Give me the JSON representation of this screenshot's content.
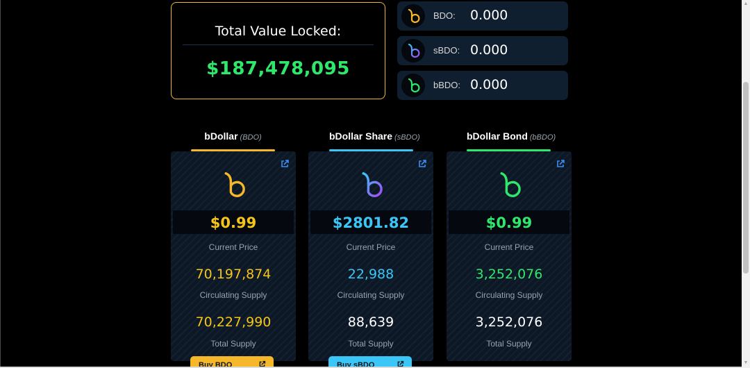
{
  "tvl": {
    "title": "Total Value Locked:",
    "value": "$187,478,095"
  },
  "balances": [
    {
      "icon": "bdo-logo-icon",
      "label": "BDO:",
      "value": "0.000",
      "color": "#f5b82a"
    },
    {
      "icon": "sbdo-logo-icon",
      "label": "sBDO:",
      "value": "0.000",
      "color": "#7f5cf7"
    },
    {
      "icon": "bbdo-logo-icon",
      "label": "bBDO:",
      "value": "0.000",
      "color": "#2fe86b"
    }
  ],
  "tokens": [
    {
      "name": "bDollar",
      "symbol": "(BDO)",
      "accent": "#f5b82a",
      "price": "$0.99",
      "price_label": "Current Price",
      "circulating": "70,197,874",
      "circulating_label": "Circulating Supply",
      "total": "70,227,990",
      "total_label": "Total Supply",
      "buy_label": "Buy BDO"
    },
    {
      "name": "bDollar Share",
      "symbol": "(sBDO)",
      "accent": "#3ac6f7",
      "price": "$2801.82",
      "price_label": "Current Price",
      "circulating": "22,988",
      "circulating_label": "Circulating Supply",
      "total": "88,639",
      "total_label": "Total Supply",
      "buy_label": "Buy sBDO"
    },
    {
      "name": "bDollar Bond",
      "symbol": "(bBDO)",
      "accent": "#2fe86b",
      "price": "$0.99",
      "price_label": "Current Price",
      "circulating": "3,252,076",
      "circulating_label": "Circulating Supply",
      "total": "3,252,076",
      "total_label": "Total Supply"
    }
  ]
}
